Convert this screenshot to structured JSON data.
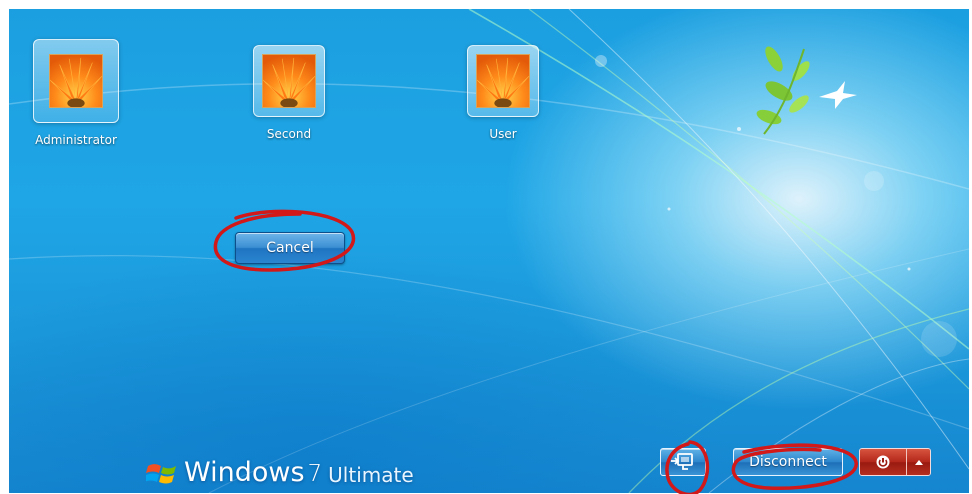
{
  "users": [
    {
      "name": "Administrator",
      "selected": true
    },
    {
      "name": "Second",
      "selected": false
    },
    {
      "name": "User",
      "selected": false
    }
  ],
  "cancel_label": "Cancel",
  "brand": {
    "logo": "windows-flag-icon",
    "word": "Windows",
    "version": "7",
    "edition": "Ultimate"
  },
  "taskbar": {
    "ease_of_access_icon": "ease-of-access-icon",
    "disconnect_label": "Disconnect",
    "shutdown_icon": "power-icon",
    "shutdown_options_icon": "triangle-up-icon"
  },
  "colors": {
    "annotation": "#d21818",
    "background": "#1fa6e6",
    "shutdown": "#b3271a"
  }
}
